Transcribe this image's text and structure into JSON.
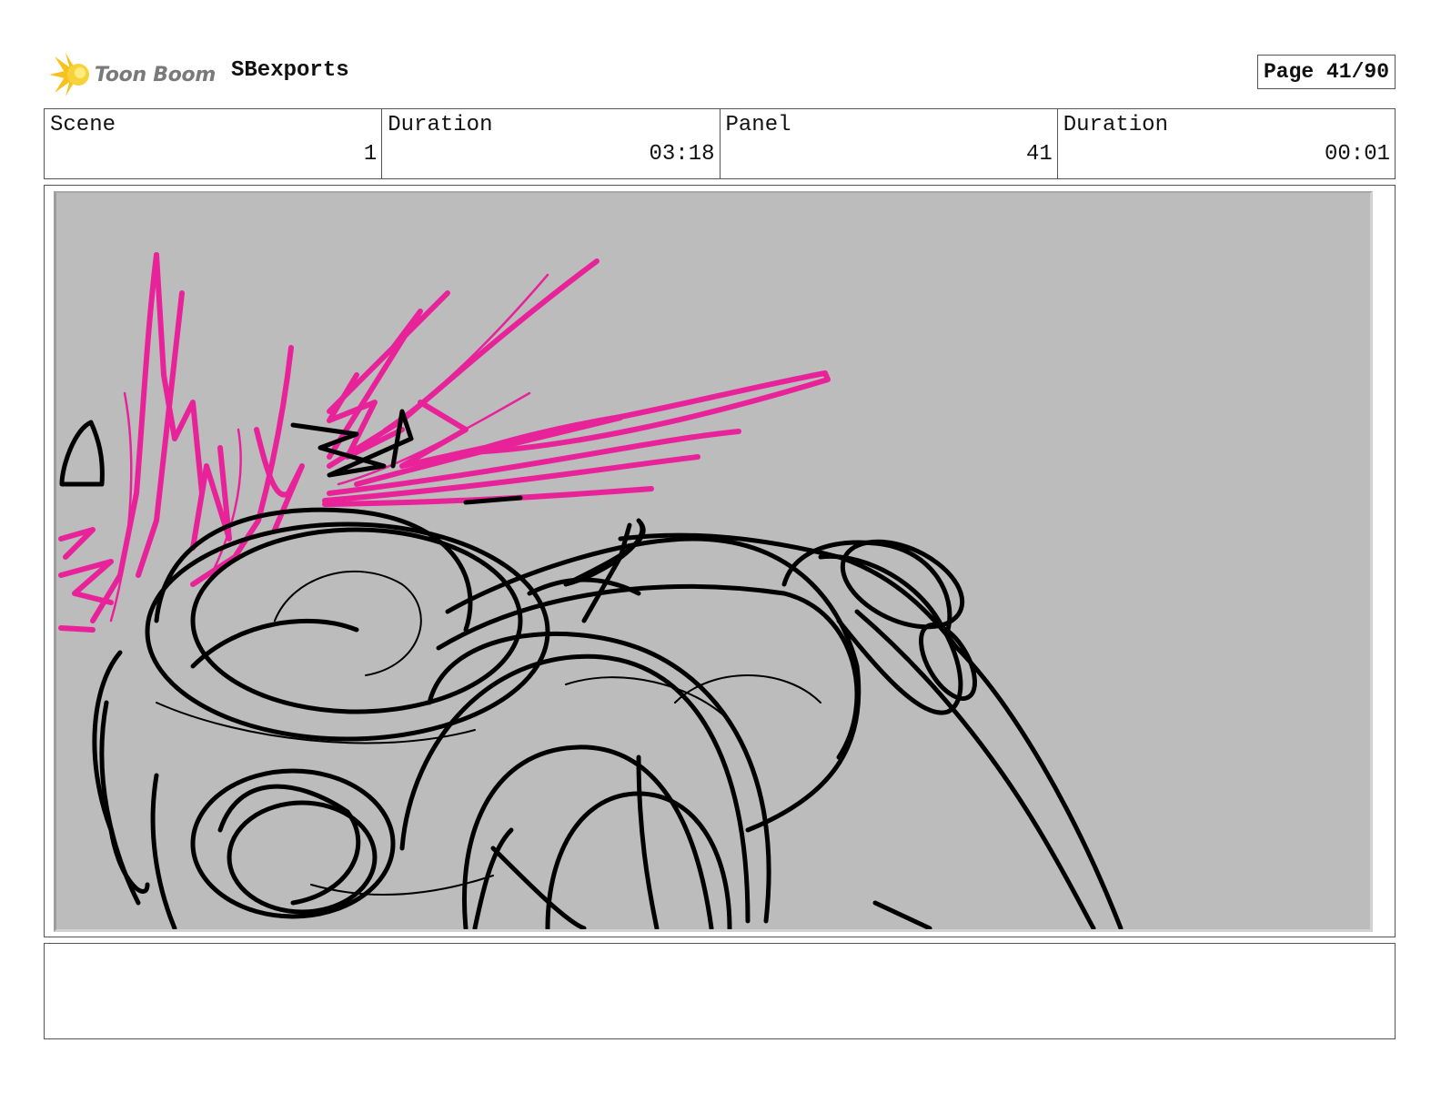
{
  "header": {
    "logo_text": "Toon Boom",
    "logo_icon": "starburst-logo-icon",
    "project_title": "SBexports",
    "page_label": "Page 41/90"
  },
  "info": {
    "scene_label": "Scene",
    "scene_value": "1",
    "scene_duration_label": "Duration",
    "scene_duration_value": "03:18",
    "panel_label": "Panel",
    "panel_value": "41",
    "panel_duration_label": "Duration",
    "panel_duration_value": "00:01"
  },
  "panel": {
    "background_color": "#bcbcbc",
    "sketch_colors": {
      "ink": "#000000",
      "accent": "#e8239a"
    }
  },
  "notes": {
    "text": ""
  }
}
